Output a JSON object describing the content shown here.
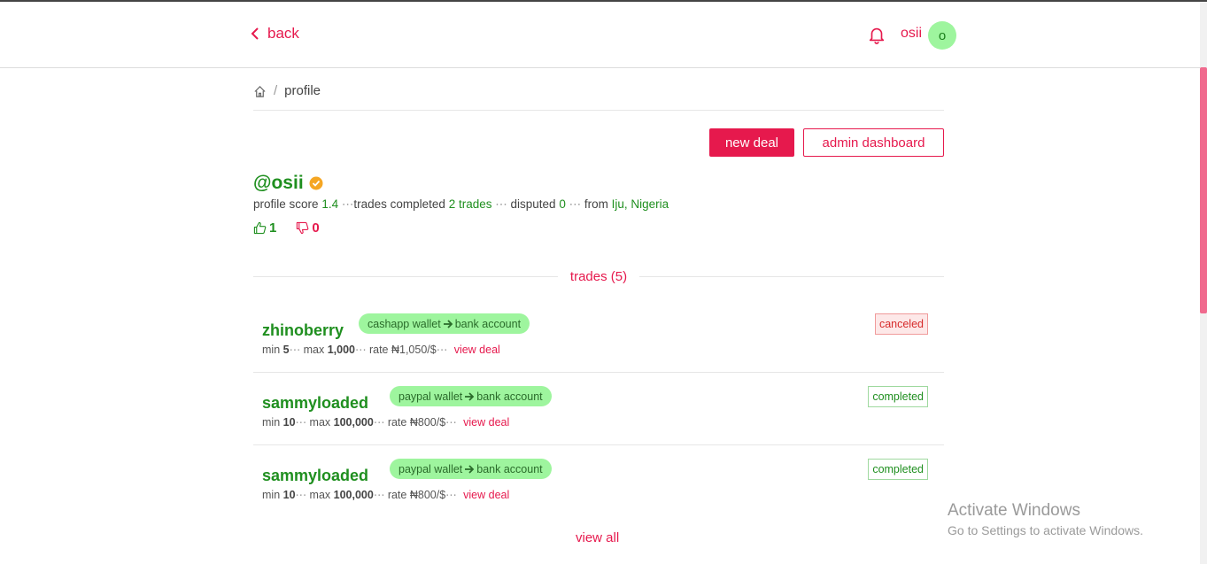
{
  "header": {
    "back_label": "back",
    "username": "osii",
    "avatar_initial": "o"
  },
  "breadcrumb": {
    "separator": "/",
    "current": "profile"
  },
  "actions": {
    "new_deal": "new deal",
    "admin_dashboard": "admin dashboard"
  },
  "profile": {
    "handle": "@osii",
    "score_label": "profile score",
    "score": "1.4",
    "trades_label": "trades completed",
    "trades": "2 trades",
    "disputed_label": "disputed",
    "disputed": "0",
    "from_label": "from",
    "location": "Iju, Nigeria",
    "likes": "1",
    "dislikes": "0"
  },
  "trades_section": {
    "title": "trades (5)",
    "view_all": "view all",
    "items": [
      {
        "name": "zhinoberry",
        "from": "cashapp wallet",
        "to": "bank account",
        "min_label": "min",
        "min": "5",
        "max_label": "max",
        "max": "1,000",
        "rate_label": "rate",
        "rate": "₦1,050/$",
        "view_label": "view deal",
        "status": "canceled"
      },
      {
        "name": "sammyloaded",
        "from": "paypal wallet",
        "to": "bank account",
        "min_label": "min",
        "min": "10",
        "max_label": "max",
        "max": "100,000",
        "rate_label": "rate",
        "rate": "₦800/$",
        "view_label": "view deal",
        "status": "completed"
      },
      {
        "name": "sammyloaded",
        "from": "paypal wallet",
        "to": "bank account",
        "min_label": "min",
        "min": "10",
        "max_label": "max",
        "max": "100,000",
        "rate_label": "rate",
        "rate": "₦800/$",
        "view_label": "view deal",
        "status": "completed"
      }
    ]
  },
  "overlay": {
    "title": "Activate Windows",
    "subtitle": "Go to Settings to activate Windows."
  },
  "colors": {
    "accent": "#e6194d",
    "success": "#1f8f1f",
    "pill": "#9ef59e"
  },
  "icons": [
    "chevron-left-icon",
    "bell-icon",
    "home-icon",
    "verified-icon",
    "thumbs-up-icon",
    "thumbs-down-icon",
    "arrow-right-icon"
  ]
}
